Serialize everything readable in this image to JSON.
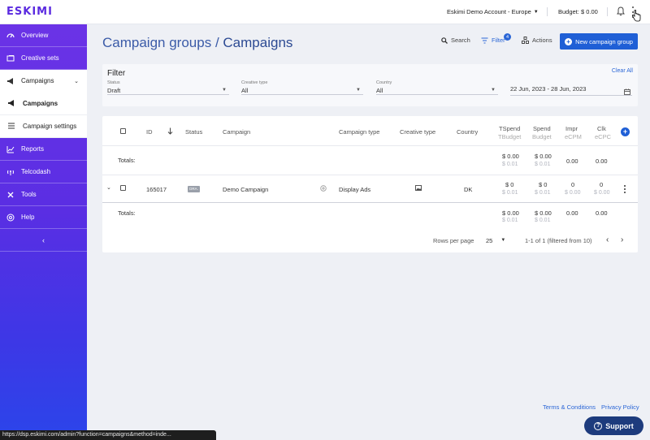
{
  "brand": {
    "logo": "ESKIMI",
    "accent": "#5b2be0",
    "primary": "#1f5fd6"
  },
  "topbar": {
    "account": "Eskimi Demo Account - Europe",
    "budget": "Budget: $ 0.00",
    "icons": [
      "caret-down-icon",
      "bell-icon",
      "kebab-icon",
      "hand-cursor-icon"
    ]
  },
  "sidebar": {
    "items": [
      {
        "label": "Overview",
        "icon": "dashboard-icon"
      },
      {
        "label": "Creative sets",
        "icon": "images-icon"
      },
      {
        "label": "Campaigns",
        "icon": "megaphone-icon"
      },
      {
        "label": "Campaigns",
        "icon": "megaphone-icon"
      },
      {
        "label": "Campaign settings",
        "icon": "list-icon"
      },
      {
        "label": "Reports",
        "icon": "chart-icon"
      },
      {
        "label": "Telcodash",
        "icon": "antenna-icon"
      },
      {
        "label": "Tools",
        "icon": "tools-icon"
      },
      {
        "label": "Help",
        "icon": "help-icon"
      }
    ],
    "collapse": "‹"
  },
  "header": {
    "breadcrumb_parent": "Campaign groups",
    "breadcrumb_sep": "/",
    "title": "Campaigns",
    "search": "Search",
    "filter": "Filter",
    "filter_count": "4",
    "actions": "Actions",
    "new_button": "New campaign group"
  },
  "filter": {
    "title": "Filter",
    "clear": "Clear All",
    "status": {
      "label": "Status",
      "value": "Draft"
    },
    "creative_type": {
      "label": "Creative type",
      "value": "All"
    },
    "country": {
      "label": "Country",
      "value": "All"
    },
    "date_range": "22 Jun, 2023 - 28 Jun, 2023"
  },
  "table": {
    "columns": {
      "id": "ID",
      "status": "Status",
      "campaign": "Campaign",
      "campaign_type": "Campaign type",
      "creative_type": "Creative type",
      "country": "Country",
      "tspend": "TSpend",
      "tbudget": "TBudget",
      "spend": "Spend",
      "budget": "Budget",
      "impr": "Impr",
      "ecpm": "eCPM",
      "clk": "Clk",
      "ecpc": "eCPC"
    },
    "totals_top": {
      "label": "Totals:",
      "tspend": "$ 0.00",
      "tbudget": "$ 0.01",
      "spend": "$ 0.00",
      "budget": "$ 0.01",
      "impr": "0.00",
      "clk": "0.00"
    },
    "row": {
      "id": "165017",
      "status": "DRA.",
      "campaign": "Demo Campaign",
      "campaign_type": "Display Ads",
      "country": "DK",
      "tspend": "$ 0",
      "tbudget": "$ 0.01",
      "spend": "$ 0",
      "budget": "$ 0.01",
      "impr": "0",
      "ecpm": "$ 0.00",
      "clk": "0",
      "ecpc": "$ 0.00"
    },
    "totals_bottom": {
      "label": "Totals:",
      "tspend": "$ 0.00",
      "tbudget": "$ 0.01",
      "spend": "$ 0.00",
      "budget": "$ 0.01",
      "impr": "0.00",
      "clk": "0.00"
    },
    "pagination": {
      "rows_label": "Rows per page",
      "rows_value": "25",
      "range": "1-1 of 1 (filtered from 10)",
      "prev": "‹",
      "next": "›"
    }
  },
  "footer": {
    "terms": "Terms & Conditions",
    "privacy": "Privacy Policy",
    "status_url": "https://dsp.eskimi.com/admin?function=campaigns&method=inde...",
    "support": "Support"
  }
}
